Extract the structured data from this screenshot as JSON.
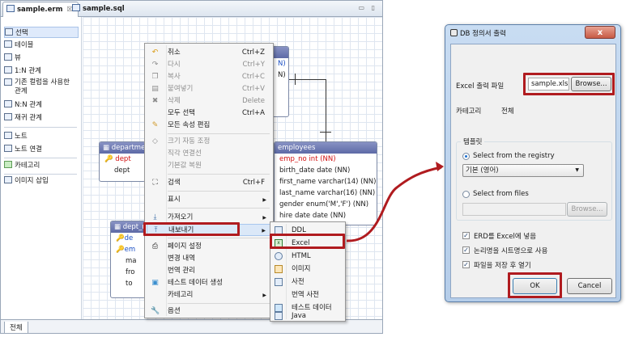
{
  "editor": {
    "tabs": [
      {
        "label": "sample.erm",
        "close": "☒"
      },
      {
        "label": "sample.sql"
      }
    ],
    "window_controls": "▭ ▯",
    "bottom_tab": "전체"
  },
  "palette": {
    "items": [
      {
        "label": "선택"
      },
      {
        "label": "테이블"
      },
      {
        "label": "뷰"
      },
      {
        "label": "1:N 관계"
      },
      {
        "label": "기존 컬럼을 사용한 관계"
      },
      {
        "label": "N:N 관계"
      },
      {
        "label": "재귀 관계"
      },
      {
        "label": "노트"
      },
      {
        "label": "노트 연결"
      },
      {
        "label": "카테고리"
      },
      {
        "label": "이미지 삽입"
      }
    ]
  },
  "diagram": {
    "departments": {
      "title": "departme",
      "rows": [
        "dept",
        "dept"
      ]
    },
    "dept_manager": {
      "title": "dept_m",
      "rows": [
        "de",
        "em",
        "ma",
        "fro",
        "to"
      ]
    },
    "employees": {
      "title": "employees",
      "rows": [
        "emp_no int (NN)",
        "birth_date date (NN)",
        "first_name varchar(14) (NN)",
        "last_name varchar(16) (NN)",
        "gender enum('M','F') (NN)",
        "hire date date (NN)"
      ]
    },
    "top_table_rows": [
      "N)",
      "N)"
    ]
  },
  "context_menu": {
    "items": [
      {
        "label": "취소",
        "shortcut": "Ctrl+Z",
        "disabled": false
      },
      {
        "label": "다시",
        "shortcut": "Ctrl+Y",
        "disabled": true
      },
      {
        "label": "복사",
        "shortcut": "Ctrl+C",
        "disabled": true
      },
      {
        "label": "붙여넣기",
        "shortcut": "Ctrl+V",
        "disabled": true
      },
      {
        "label": "삭제",
        "shortcut": "Delete",
        "disabled": true
      },
      {
        "label": "모두 선택",
        "shortcut": "Ctrl+A",
        "disabled": false
      },
      {
        "label": "모든 속성 편집",
        "shortcut": "",
        "disabled": false
      },
      {
        "label": "크기 자동 조정",
        "shortcut": "",
        "disabled": true
      },
      {
        "label": "직각 연결선",
        "shortcut": "",
        "disabled": true
      },
      {
        "label": "기본값 복원",
        "shortcut": "",
        "disabled": true
      },
      {
        "label": "검색",
        "shortcut": "Ctrl+F",
        "disabled": false
      },
      {
        "label": "표시",
        "shortcut": "",
        "disabled": false
      },
      {
        "label": "가져오기",
        "shortcut": "",
        "disabled": false
      },
      {
        "label": "내보내기",
        "shortcut": "",
        "disabled": false
      },
      {
        "label": "페이지 설정",
        "shortcut": "",
        "disabled": false
      },
      {
        "label": "변경 내역",
        "shortcut": "",
        "disabled": false
      },
      {
        "label": "번역 관리",
        "shortcut": "",
        "disabled": false
      },
      {
        "label": "테스트 데이터 생성",
        "shortcut": "",
        "disabled": false
      },
      {
        "label": "카테고리",
        "shortcut": "",
        "disabled": false
      },
      {
        "label": "옵션",
        "shortcut": "",
        "disabled": false
      }
    ]
  },
  "export_submenu": {
    "items": [
      {
        "label": "DDL"
      },
      {
        "label": "Excel"
      },
      {
        "label": "HTML"
      },
      {
        "label": "이미지"
      },
      {
        "label": "사전"
      },
      {
        "label": "번역 사전"
      },
      {
        "label": "테스트 데이터"
      },
      {
        "label": "Java"
      }
    ]
  },
  "dialog": {
    "title": "DB 정의서 출력",
    "close": "x",
    "excel_label": "Excel 출력 파일",
    "excel_value": "sample.xls",
    "browse": "Browse...",
    "category_label": "카테고리",
    "category_value": "전체",
    "template_group": "템플릿",
    "radio_registry": "Select from the registry",
    "combo_value": "기본 (영어)",
    "radio_files": "Select from files",
    "browse_disabled": "Browse...",
    "check1": "ERD를 Excel에 넣음",
    "check2": "논리명을 시트명으로 사용",
    "check3": "파일을 저장 후 열기",
    "ok": "OK",
    "cancel": "Cancel"
  },
  "colors": {
    "highlight": "#b01b1f",
    "table_header": "#5d6aa6",
    "pk_red": "#d10f0f"
  }
}
